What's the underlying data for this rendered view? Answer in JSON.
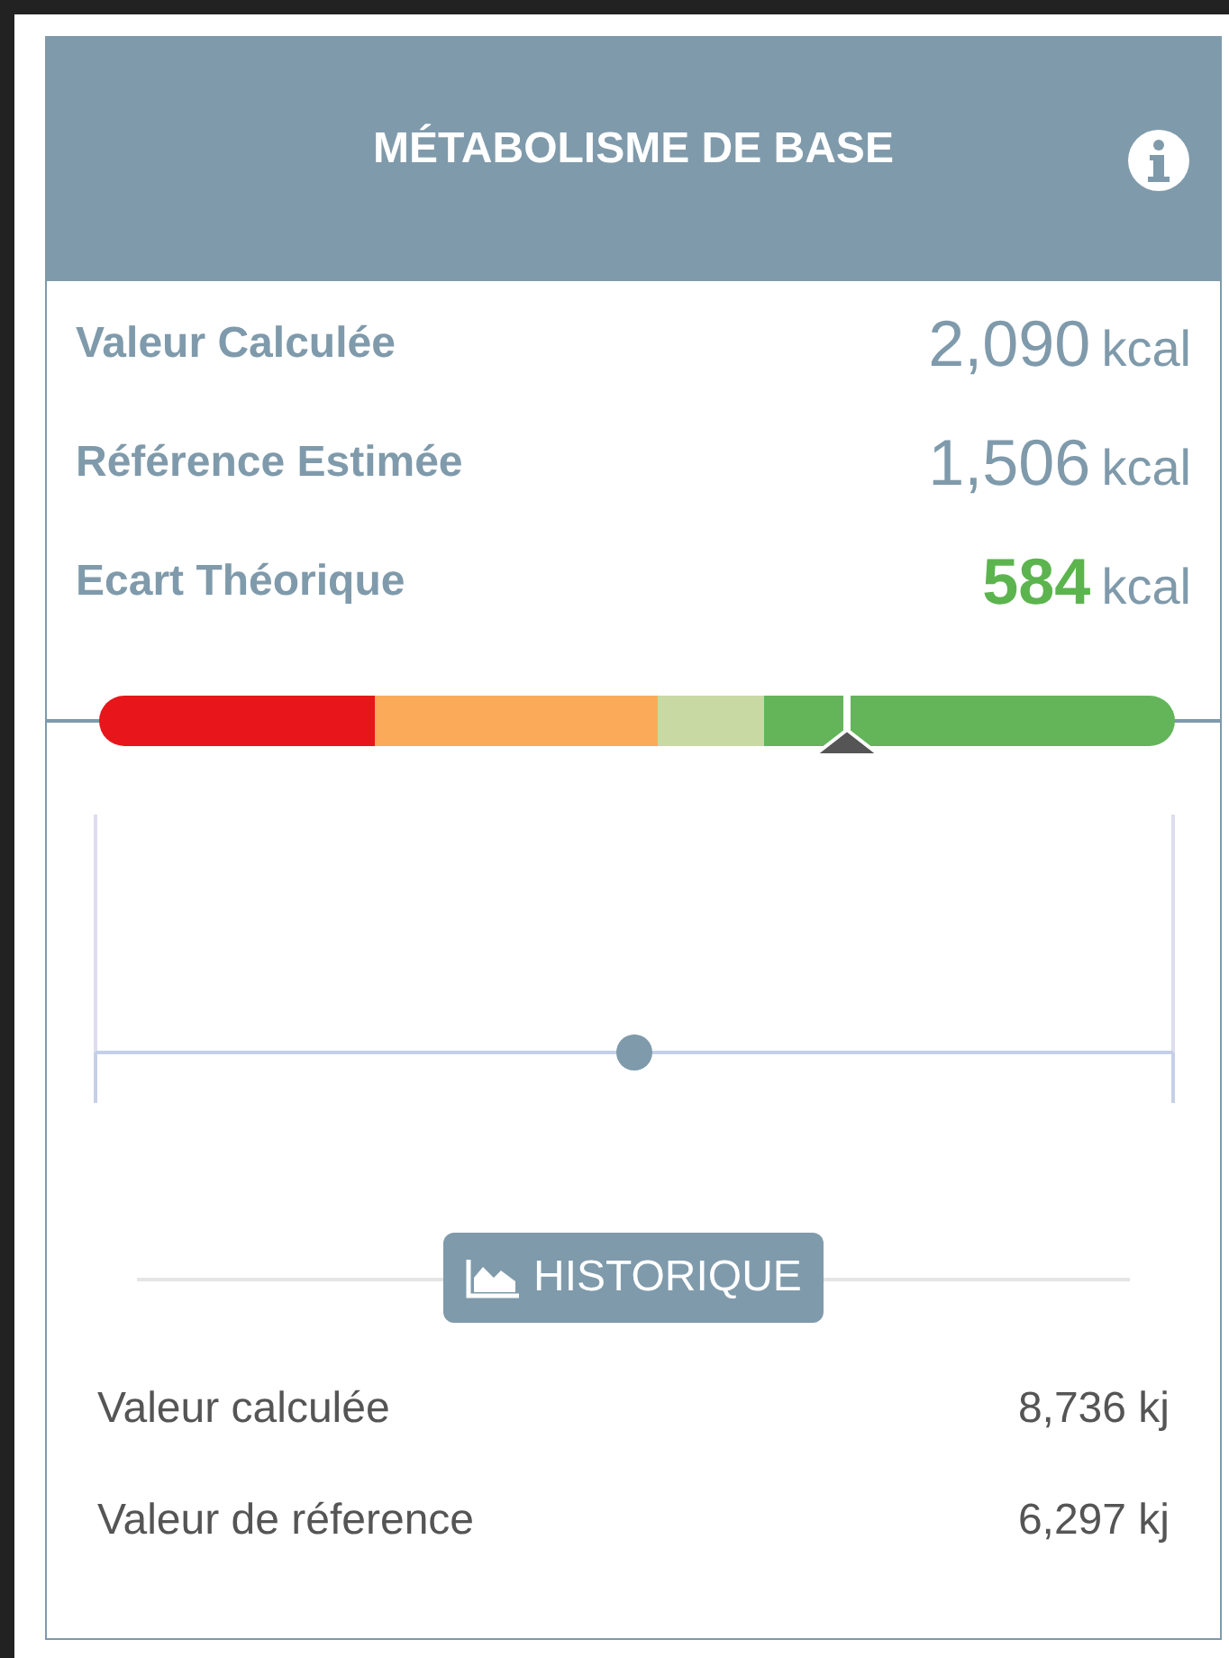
{
  "header": {
    "title": "MÉTABOLISME DE BASE"
  },
  "metrics": [
    {
      "label": "Valeur Calculée",
      "value": "2,090",
      "unit": "kcal",
      "kind": "normal"
    },
    {
      "label": "Référence Estimée",
      "value": "1,506",
      "unit": "kcal",
      "kind": "normal"
    },
    {
      "label": "Ecart Théorique",
      "value": "584",
      "unit": "kcal",
      "kind": "highlight"
    }
  ],
  "gauge": {
    "level": 0.695,
    "segments": [
      {
        "color": "#e8161a"
      },
      {
        "color": "#fbaa5a"
      },
      {
        "color": "#c9d9a4"
      },
      {
        "color": "#64b55a"
      }
    ]
  },
  "history_button": {
    "label": "HISTORIQUE"
  },
  "history": [
    {
      "label": "Valeur calculée",
      "value": "8,736 kj"
    },
    {
      "label": "Valeur de réference",
      "value": "6,297 kj"
    }
  ]
}
